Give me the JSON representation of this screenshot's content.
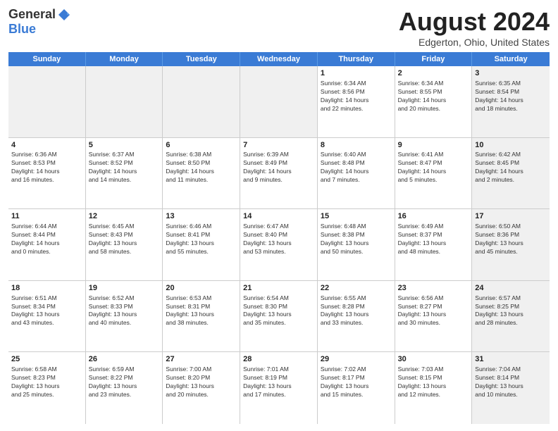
{
  "logo": {
    "general": "General",
    "blue": "Blue"
  },
  "title": "August 2024",
  "subtitle": "Edgerton, Ohio, United States",
  "header_days": [
    "Sunday",
    "Monday",
    "Tuesday",
    "Wednesday",
    "Thursday",
    "Friday",
    "Saturday"
  ],
  "weeks": [
    [
      {
        "day": "",
        "content": "",
        "shaded": true
      },
      {
        "day": "",
        "content": "",
        "shaded": true
      },
      {
        "day": "",
        "content": "",
        "shaded": true
      },
      {
        "day": "",
        "content": "",
        "shaded": true
      },
      {
        "day": "1",
        "content": "Sunrise: 6:34 AM\nSunset: 8:56 PM\nDaylight: 14 hours\nand 22 minutes.",
        "shaded": false
      },
      {
        "day": "2",
        "content": "Sunrise: 6:34 AM\nSunset: 8:55 PM\nDaylight: 14 hours\nand 20 minutes.",
        "shaded": false
      },
      {
        "day": "3",
        "content": "Sunrise: 6:35 AM\nSunset: 8:54 PM\nDaylight: 14 hours\nand 18 minutes.",
        "shaded": true
      }
    ],
    [
      {
        "day": "4",
        "content": "Sunrise: 6:36 AM\nSunset: 8:53 PM\nDaylight: 14 hours\nand 16 minutes.",
        "shaded": false
      },
      {
        "day": "5",
        "content": "Sunrise: 6:37 AM\nSunset: 8:52 PM\nDaylight: 14 hours\nand 14 minutes.",
        "shaded": false
      },
      {
        "day": "6",
        "content": "Sunrise: 6:38 AM\nSunset: 8:50 PM\nDaylight: 14 hours\nand 11 minutes.",
        "shaded": false
      },
      {
        "day": "7",
        "content": "Sunrise: 6:39 AM\nSunset: 8:49 PM\nDaylight: 14 hours\nand 9 minutes.",
        "shaded": false
      },
      {
        "day": "8",
        "content": "Sunrise: 6:40 AM\nSunset: 8:48 PM\nDaylight: 14 hours\nand 7 minutes.",
        "shaded": false
      },
      {
        "day": "9",
        "content": "Sunrise: 6:41 AM\nSunset: 8:47 PM\nDaylight: 14 hours\nand 5 minutes.",
        "shaded": false
      },
      {
        "day": "10",
        "content": "Sunrise: 6:42 AM\nSunset: 8:45 PM\nDaylight: 14 hours\nand 2 minutes.",
        "shaded": true
      }
    ],
    [
      {
        "day": "11",
        "content": "Sunrise: 6:44 AM\nSunset: 8:44 PM\nDaylight: 14 hours\nand 0 minutes.",
        "shaded": false
      },
      {
        "day": "12",
        "content": "Sunrise: 6:45 AM\nSunset: 8:43 PM\nDaylight: 13 hours\nand 58 minutes.",
        "shaded": false
      },
      {
        "day": "13",
        "content": "Sunrise: 6:46 AM\nSunset: 8:41 PM\nDaylight: 13 hours\nand 55 minutes.",
        "shaded": false
      },
      {
        "day": "14",
        "content": "Sunrise: 6:47 AM\nSunset: 8:40 PM\nDaylight: 13 hours\nand 53 minutes.",
        "shaded": false
      },
      {
        "day": "15",
        "content": "Sunrise: 6:48 AM\nSunset: 8:38 PM\nDaylight: 13 hours\nand 50 minutes.",
        "shaded": false
      },
      {
        "day": "16",
        "content": "Sunrise: 6:49 AM\nSunset: 8:37 PM\nDaylight: 13 hours\nand 48 minutes.",
        "shaded": false
      },
      {
        "day": "17",
        "content": "Sunrise: 6:50 AM\nSunset: 8:36 PM\nDaylight: 13 hours\nand 45 minutes.",
        "shaded": true
      }
    ],
    [
      {
        "day": "18",
        "content": "Sunrise: 6:51 AM\nSunset: 8:34 PM\nDaylight: 13 hours\nand 43 minutes.",
        "shaded": false
      },
      {
        "day": "19",
        "content": "Sunrise: 6:52 AM\nSunset: 8:33 PM\nDaylight: 13 hours\nand 40 minutes.",
        "shaded": false
      },
      {
        "day": "20",
        "content": "Sunrise: 6:53 AM\nSunset: 8:31 PM\nDaylight: 13 hours\nand 38 minutes.",
        "shaded": false
      },
      {
        "day": "21",
        "content": "Sunrise: 6:54 AM\nSunset: 8:30 PM\nDaylight: 13 hours\nand 35 minutes.",
        "shaded": false
      },
      {
        "day": "22",
        "content": "Sunrise: 6:55 AM\nSunset: 8:28 PM\nDaylight: 13 hours\nand 33 minutes.",
        "shaded": false
      },
      {
        "day": "23",
        "content": "Sunrise: 6:56 AM\nSunset: 8:27 PM\nDaylight: 13 hours\nand 30 minutes.",
        "shaded": false
      },
      {
        "day": "24",
        "content": "Sunrise: 6:57 AM\nSunset: 8:25 PM\nDaylight: 13 hours\nand 28 minutes.",
        "shaded": true
      }
    ],
    [
      {
        "day": "25",
        "content": "Sunrise: 6:58 AM\nSunset: 8:23 PM\nDaylight: 13 hours\nand 25 minutes.",
        "shaded": false
      },
      {
        "day": "26",
        "content": "Sunrise: 6:59 AM\nSunset: 8:22 PM\nDaylight: 13 hours\nand 23 minutes.",
        "shaded": false
      },
      {
        "day": "27",
        "content": "Sunrise: 7:00 AM\nSunset: 8:20 PM\nDaylight: 13 hours\nand 20 minutes.",
        "shaded": false
      },
      {
        "day": "28",
        "content": "Sunrise: 7:01 AM\nSunset: 8:19 PM\nDaylight: 13 hours\nand 17 minutes.",
        "shaded": false
      },
      {
        "day": "29",
        "content": "Sunrise: 7:02 AM\nSunset: 8:17 PM\nDaylight: 13 hours\nand 15 minutes.",
        "shaded": false
      },
      {
        "day": "30",
        "content": "Sunrise: 7:03 AM\nSunset: 8:15 PM\nDaylight: 13 hours\nand 12 minutes.",
        "shaded": false
      },
      {
        "day": "31",
        "content": "Sunrise: 7:04 AM\nSunset: 8:14 PM\nDaylight: 13 hours\nand 10 minutes.",
        "shaded": true
      }
    ]
  ]
}
